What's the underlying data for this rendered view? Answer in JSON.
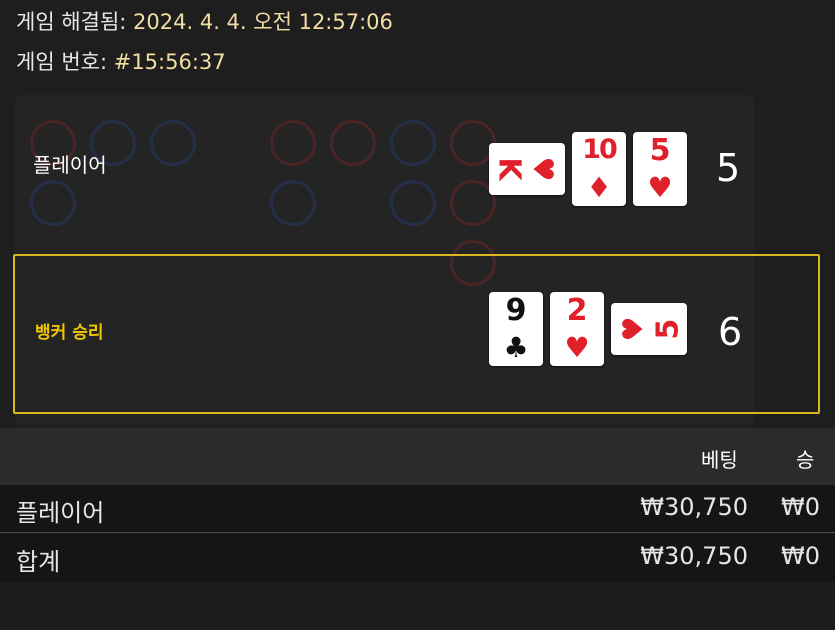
{
  "header": {
    "resolved_label": "게임 해결됨:",
    "resolved_value": "2024. 4. 4. 오전 12:57:06",
    "game_number_label": "게임 번호:",
    "game_number_value": "#15:56:37"
  },
  "player": {
    "label": "플레이어",
    "score": "5",
    "cards": [
      {
        "rank": "K",
        "suit": "♥",
        "color": "#e0202a",
        "orientation": "sideways"
      },
      {
        "rank": "10",
        "suit": "♦",
        "color": "#e0202a",
        "orientation": "upright"
      },
      {
        "rank": "5",
        "suit": "♥",
        "color": "#e0202a",
        "orientation": "upright"
      }
    ]
  },
  "banker": {
    "label": "뱅커 승리",
    "score": "6",
    "highlight_color": "#d8b81c",
    "cards": [
      {
        "rank": "9",
        "suit": "♣",
        "color": "#111111",
        "orientation": "upright"
      },
      {
        "rank": "2",
        "suit": "♥",
        "color": "#e0202a",
        "orientation": "upright"
      },
      {
        "rank": "5",
        "suit": "♥",
        "color": "#e0202a",
        "orientation": "sideways"
      }
    ]
  },
  "bets_table": {
    "columns": [
      "베팅",
      "승"
    ],
    "rows": [
      {
        "name": "플레이어",
        "bet": "₩30,750",
        "win": "₩0"
      }
    ],
    "total": {
      "name": "합계",
      "bet": "₩30,750",
      "win": "₩0"
    }
  }
}
